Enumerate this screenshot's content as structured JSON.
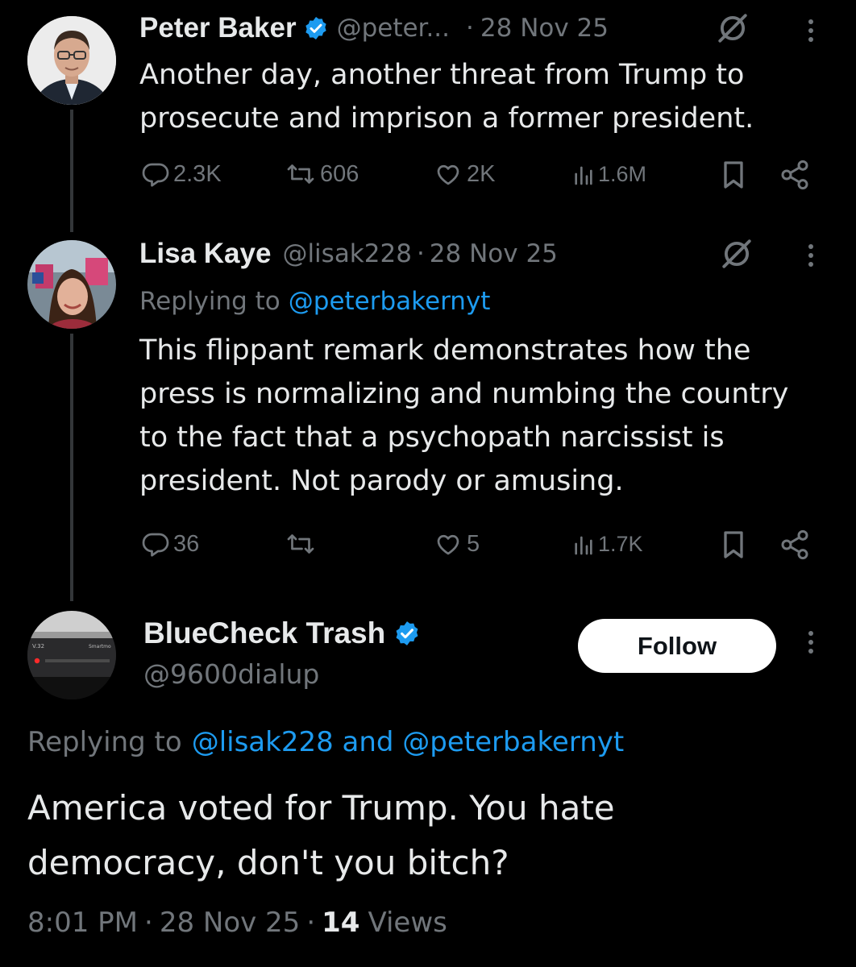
{
  "tweets": [
    {
      "name": "Peter Baker",
      "verified": true,
      "handle": "@peter...",
      "date": "28 Nov 25",
      "text_lines": [
        "Another day, another threat from Trump to",
        "prosecute and imprison a former president."
      ],
      "replies": "2.3K",
      "reposts": "606",
      "likes": "2K",
      "views": "1.6M"
    },
    {
      "name": "Lisa Kaye",
      "verified": false,
      "handle": "@lisak228",
      "date": "28 Nov 25",
      "replying_prefix": "Replying to",
      "replying_to": "@peterbakernyt",
      "text_lines": [
        "This flippant remark demonstrates how the",
        "press is normalizing and numbing the country",
        "to the fact that a psychopath narcissist is",
        "president. Not parody or amusing."
      ],
      "replies": "36",
      "reposts": "",
      "likes": "5",
      "views": "1.7K"
    }
  ],
  "main_tweet": {
    "name": "BlueCheck Trash",
    "verified": true,
    "handle": "@9600dialup",
    "follow_label": "Follow",
    "replying_prefix": "Replying to",
    "replying_to": "@lisak228 and @peterbakernyt",
    "text_lines": [
      "America voted for Trump. You hate",
      "democracy, don't you bitch?"
    ],
    "time": "8:01 PM",
    "date": "28 Nov 25",
    "views_count": "14",
    "views_label": "Views",
    "avatar_device_text": [
      "V.32",
      "Smartmo"
    ]
  },
  "separator": "·",
  "colors": {
    "background": "#000000",
    "text": "#e7e9ea",
    "muted": "#71767b",
    "link": "#1d9bf0",
    "verified": "#1d9bf0"
  },
  "icons": [
    "verified-badge-icon",
    "grok-icon",
    "more-icon",
    "reply-icon",
    "repost-icon",
    "like-icon",
    "views-icon",
    "bookmark-icon",
    "share-icon"
  ]
}
